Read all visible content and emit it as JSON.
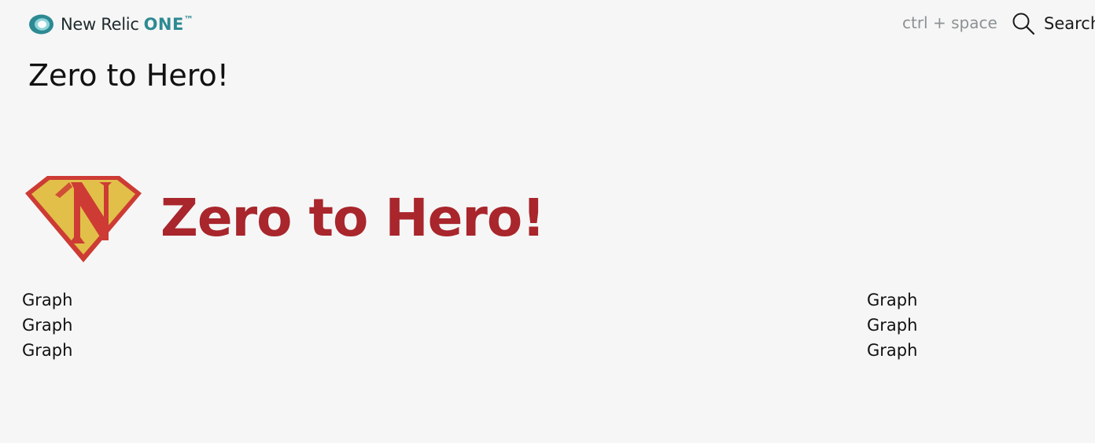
{
  "header": {
    "brand_name": "New Relic",
    "brand_product": "ONE",
    "brand_tm": "™",
    "shortcut_hint": "ctrl + space",
    "search_label": "Search",
    "logo_icon": "new-relic-logo",
    "search_icon": "search-icon"
  },
  "page": {
    "title": "Zero to Hero!"
  },
  "hero": {
    "text": "Zero to Hero!",
    "emblem_icon": "superhero-shield-emblem",
    "colors": {
      "text": "#a8262c",
      "emblem_fill": "#e2bf48",
      "emblem_stroke": "#cd3b34"
    }
  },
  "widgets": {
    "left": [
      "Graph",
      "Graph",
      "Graph"
    ],
    "right": [
      "Graph",
      "Graph",
      "Graph"
    ]
  },
  "colors": {
    "background": "#f6f6f6",
    "brand_accent": "#2d8a93",
    "muted_text": "#8c9194"
  }
}
